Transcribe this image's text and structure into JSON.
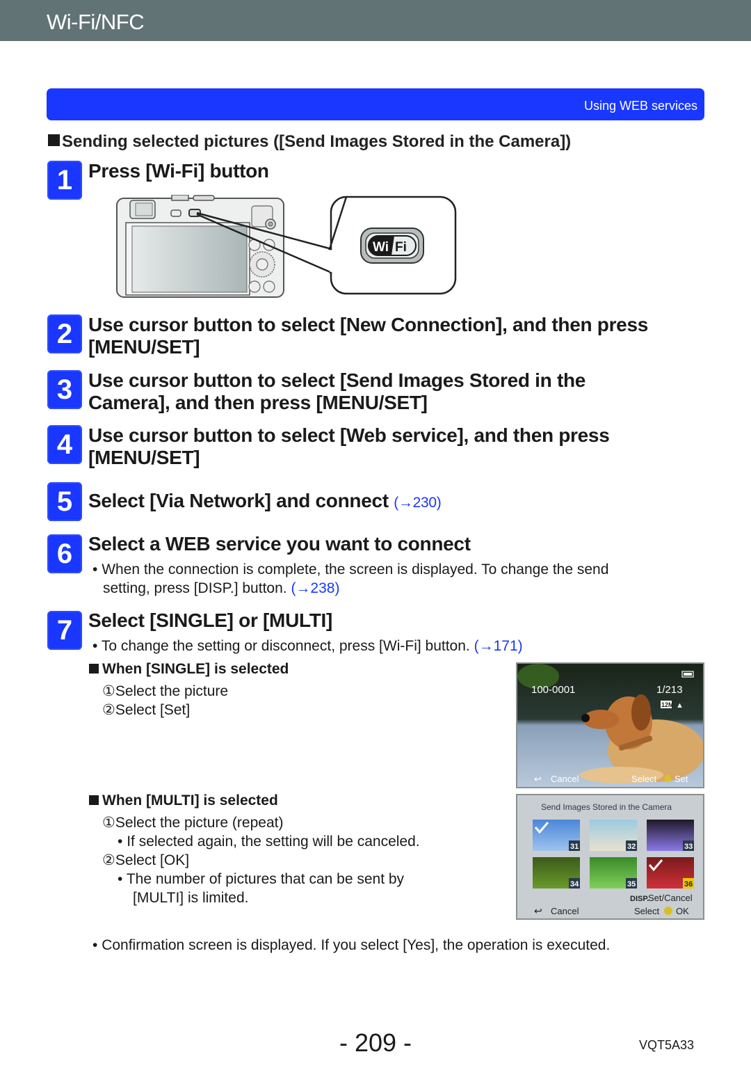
{
  "header": {
    "title": "Wi-Fi/NFC"
  },
  "section_bar": {
    "label": "Using WEB services"
  },
  "subheading": "Sending selected pictures ([Send Images Stored in the Camera])",
  "steps": [
    {
      "number": "1",
      "text": "Press [Wi-Fi] button"
    },
    {
      "number": "2",
      "line1": "Use cursor button to select [New Connection], and then press",
      "line2": "[MENU/SET]"
    },
    {
      "number": "3",
      "line1": "Use cursor button to select [Send Images Stored in the",
      "line2": "Camera], and then press [MENU/SET]"
    },
    {
      "number": "4",
      "line1": "Use cursor button to select [Web service], and then press",
      "line2": "[MENU/SET]"
    },
    {
      "number": "5",
      "text": "Select [Via Network] and connect",
      "ref": "(→230)"
    },
    {
      "number": "6",
      "text": "Select a WEB service you want to connect",
      "note_line1": "When the connection is complete, the screen is displayed. To change the send",
      "note_line2": "setting, press [DISP.] button.",
      "note_ref": "(→238)"
    },
    {
      "number": "7",
      "text": "Select [SINGLE] or [MULTI]",
      "note": "To change the setting or disconnect, press [Wi-Fi] button.",
      "note_ref": "(→171)"
    }
  ],
  "wifi_button": {
    "left": "Wi",
    "right": "Fi"
  },
  "single": {
    "heading": "When [SINGLE] is selected",
    "items": [
      "①Select the picture",
      "②Select [Set]"
    ],
    "screen": {
      "file_no": "100-0001",
      "counter": "1/213",
      "size": "12M",
      "cancel": "Cancel",
      "select": "Select",
      "set": "Set"
    }
  },
  "multi": {
    "heading": "When [MULTI] is selected",
    "item1": "①Select the picture (repeat)",
    "item1_note": "If selected again, the setting will be canceled.",
    "item2": "②Select [OK]",
    "item2_note_line1": "The number of pictures that can be sent by",
    "item2_note_line2": "[MULTI] is limited.",
    "screen": {
      "title": "Send Images Stored in the Camera",
      "thumbs": [
        {
          "num": "31",
          "checked": true,
          "colors": [
            "#4a86d8",
            "#9fc3ee"
          ]
        },
        {
          "num": "32",
          "checked": false,
          "colors": [
            "#9ccbe0",
            "#e8e2d0"
          ]
        },
        {
          "num": "33",
          "checked": false,
          "colors": [
            "#201828",
            "#8a7ae8"
          ]
        },
        {
          "num": "34",
          "checked": false,
          "colors": [
            "#3b5a1a",
            "#6a9a2a"
          ]
        },
        {
          "num": "35",
          "checked": false,
          "colors": [
            "#3a8a2a",
            "#7fd05a"
          ]
        },
        {
          "num": "36",
          "checked": true,
          "colors": [
            "#7a1a1a",
            "#d0303a"
          ],
          "highlight": true
        }
      ],
      "disp": "DISP.",
      "set_cancel": "Set/Cancel",
      "cancel": "Cancel",
      "select": "Select",
      "ok": "OK"
    }
  },
  "footer_note": "Confirmation screen is displayed. If you select [Yes], the operation is executed.",
  "page_number": "- 209 -",
  "doc_code": "VQT5A33",
  "colors": {
    "accent": "#1937ff",
    "header": "#627375"
  }
}
